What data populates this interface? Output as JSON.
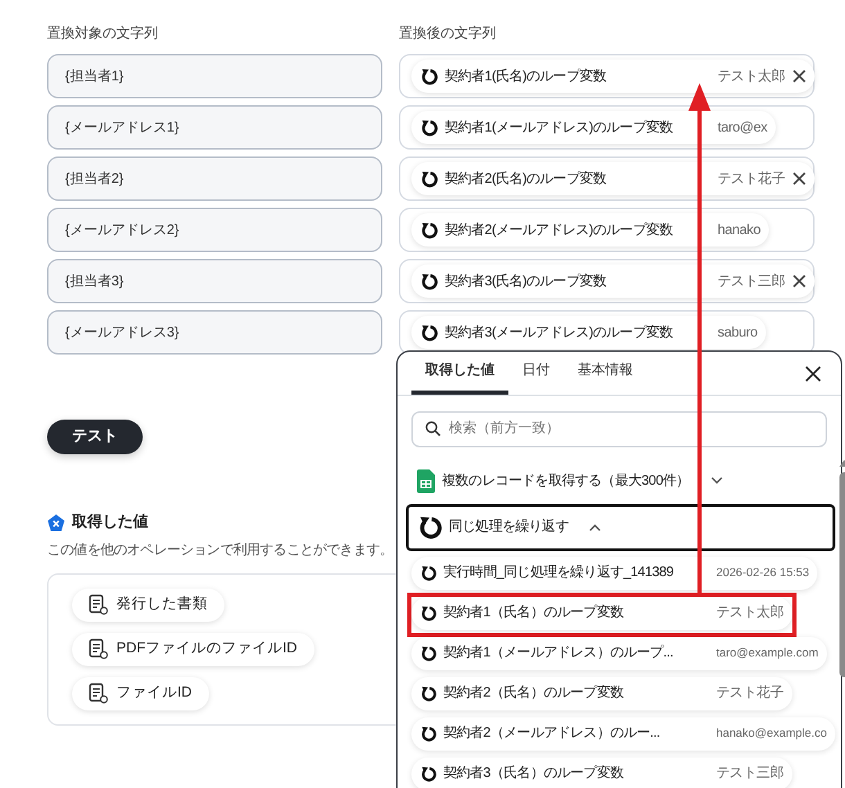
{
  "replace_table": {
    "source_label": "置換対象の文字列",
    "target_label": "置換後の文字列",
    "rows": [
      {
        "source": "{担当者1}",
        "target": {
          "label": "契約者1(氏名)のループ変数",
          "value": "テスト太郎",
          "removable": true
        }
      },
      {
        "source": "{メールアドレス1}",
        "target": {
          "label": "契約者1(メールアドレス)のループ変数",
          "value": "taro@ex",
          "removable": false
        }
      },
      {
        "source": "{担当者2}",
        "target": {
          "label": "契約者2(氏名)のループ変数",
          "value": "テスト花子",
          "removable": true
        }
      },
      {
        "source": "{メールアドレス2}",
        "target": {
          "label": "契約者2(メールアドレス)のループ変数",
          "value": "hanako",
          "removable": false
        }
      },
      {
        "source": "{担当者3}",
        "target": {
          "label": "契約者3(氏名)のループ変数",
          "value": "テスト三郎",
          "removable": true
        }
      },
      {
        "source": "{メールアドレス3}",
        "target": {
          "label": "契約者3(メールアドレス)のループ変数",
          "value": "saburo",
          "removable": false
        }
      }
    ]
  },
  "test_button": "テスト",
  "output_section": {
    "title": "取得した値",
    "description": "この値を他のオペレーションで利用することができます。",
    "items": [
      {
        "label": "発行した書類"
      },
      {
        "label": "PDFファイルのファイルID"
      },
      {
        "label": "ファイルID"
      }
    ]
  },
  "value_picker": {
    "tabs": [
      {
        "label": "取得した値",
        "selected": true
      },
      {
        "label": "日付",
        "selected": false
      },
      {
        "label": "基本情報",
        "selected": false
      }
    ],
    "search": {
      "placeholder": "検索（前方一致）"
    },
    "groups": [
      {
        "kind": "sheets",
        "label": "複数のレコードを取得する（最大300件）",
        "expanded": false,
        "selected": false
      },
      {
        "kind": "loop",
        "label": "同じ処理を繰り返す",
        "expanded": true,
        "selected": true,
        "children": [
          {
            "label": "実行時間_同じ処理を繰り返す_141389",
            "value": "2026-02-26 15:53",
            "highlighted": false
          },
          {
            "label": "契約者1（氏名）のループ変数",
            "value": "テスト太郎",
            "highlighted": true
          },
          {
            "label": "契約者1（メールアドレス）のループ...",
            "value": "taro@example.com",
            "highlighted": false
          },
          {
            "label": "契約者2（氏名）のループ変数",
            "value": "テスト花子",
            "highlighted": false
          },
          {
            "label": "契約者2（メールアドレス）のルー...",
            "value": "hanako@example.co",
            "highlighted": false
          },
          {
            "label": "契約者3（氏名）のループ変数",
            "value": "テスト三郎",
            "highlighted": false
          }
        ]
      }
    ]
  },
  "annotation": {
    "arrow": true
  }
}
